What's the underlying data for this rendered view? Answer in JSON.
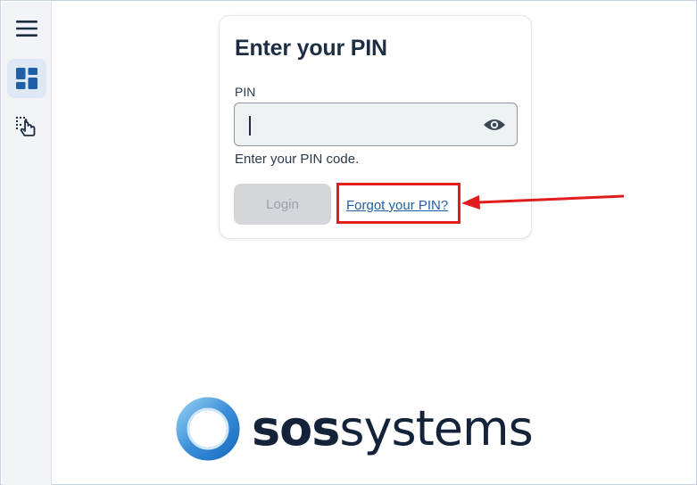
{
  "sidebar": {
    "items": [
      {
        "icon": "hamburger-menu-icon"
      },
      {
        "icon": "dashboard-icon",
        "active": true
      },
      {
        "icon": "touch-tap-icon"
      }
    ]
  },
  "card": {
    "title": "Enter your PIN",
    "pin_label": "PIN",
    "pin_value": "",
    "helper": "Enter your PIN code.",
    "login_label": "Login",
    "forgot_label": "Forgot your PIN?"
  },
  "logo": {
    "text_bold": "sos",
    "text_regular": "systems"
  },
  "colors": {
    "accent": "#1f5fa8",
    "annotation": "#e01c1c",
    "logo_ring": "#3b8fd9"
  }
}
